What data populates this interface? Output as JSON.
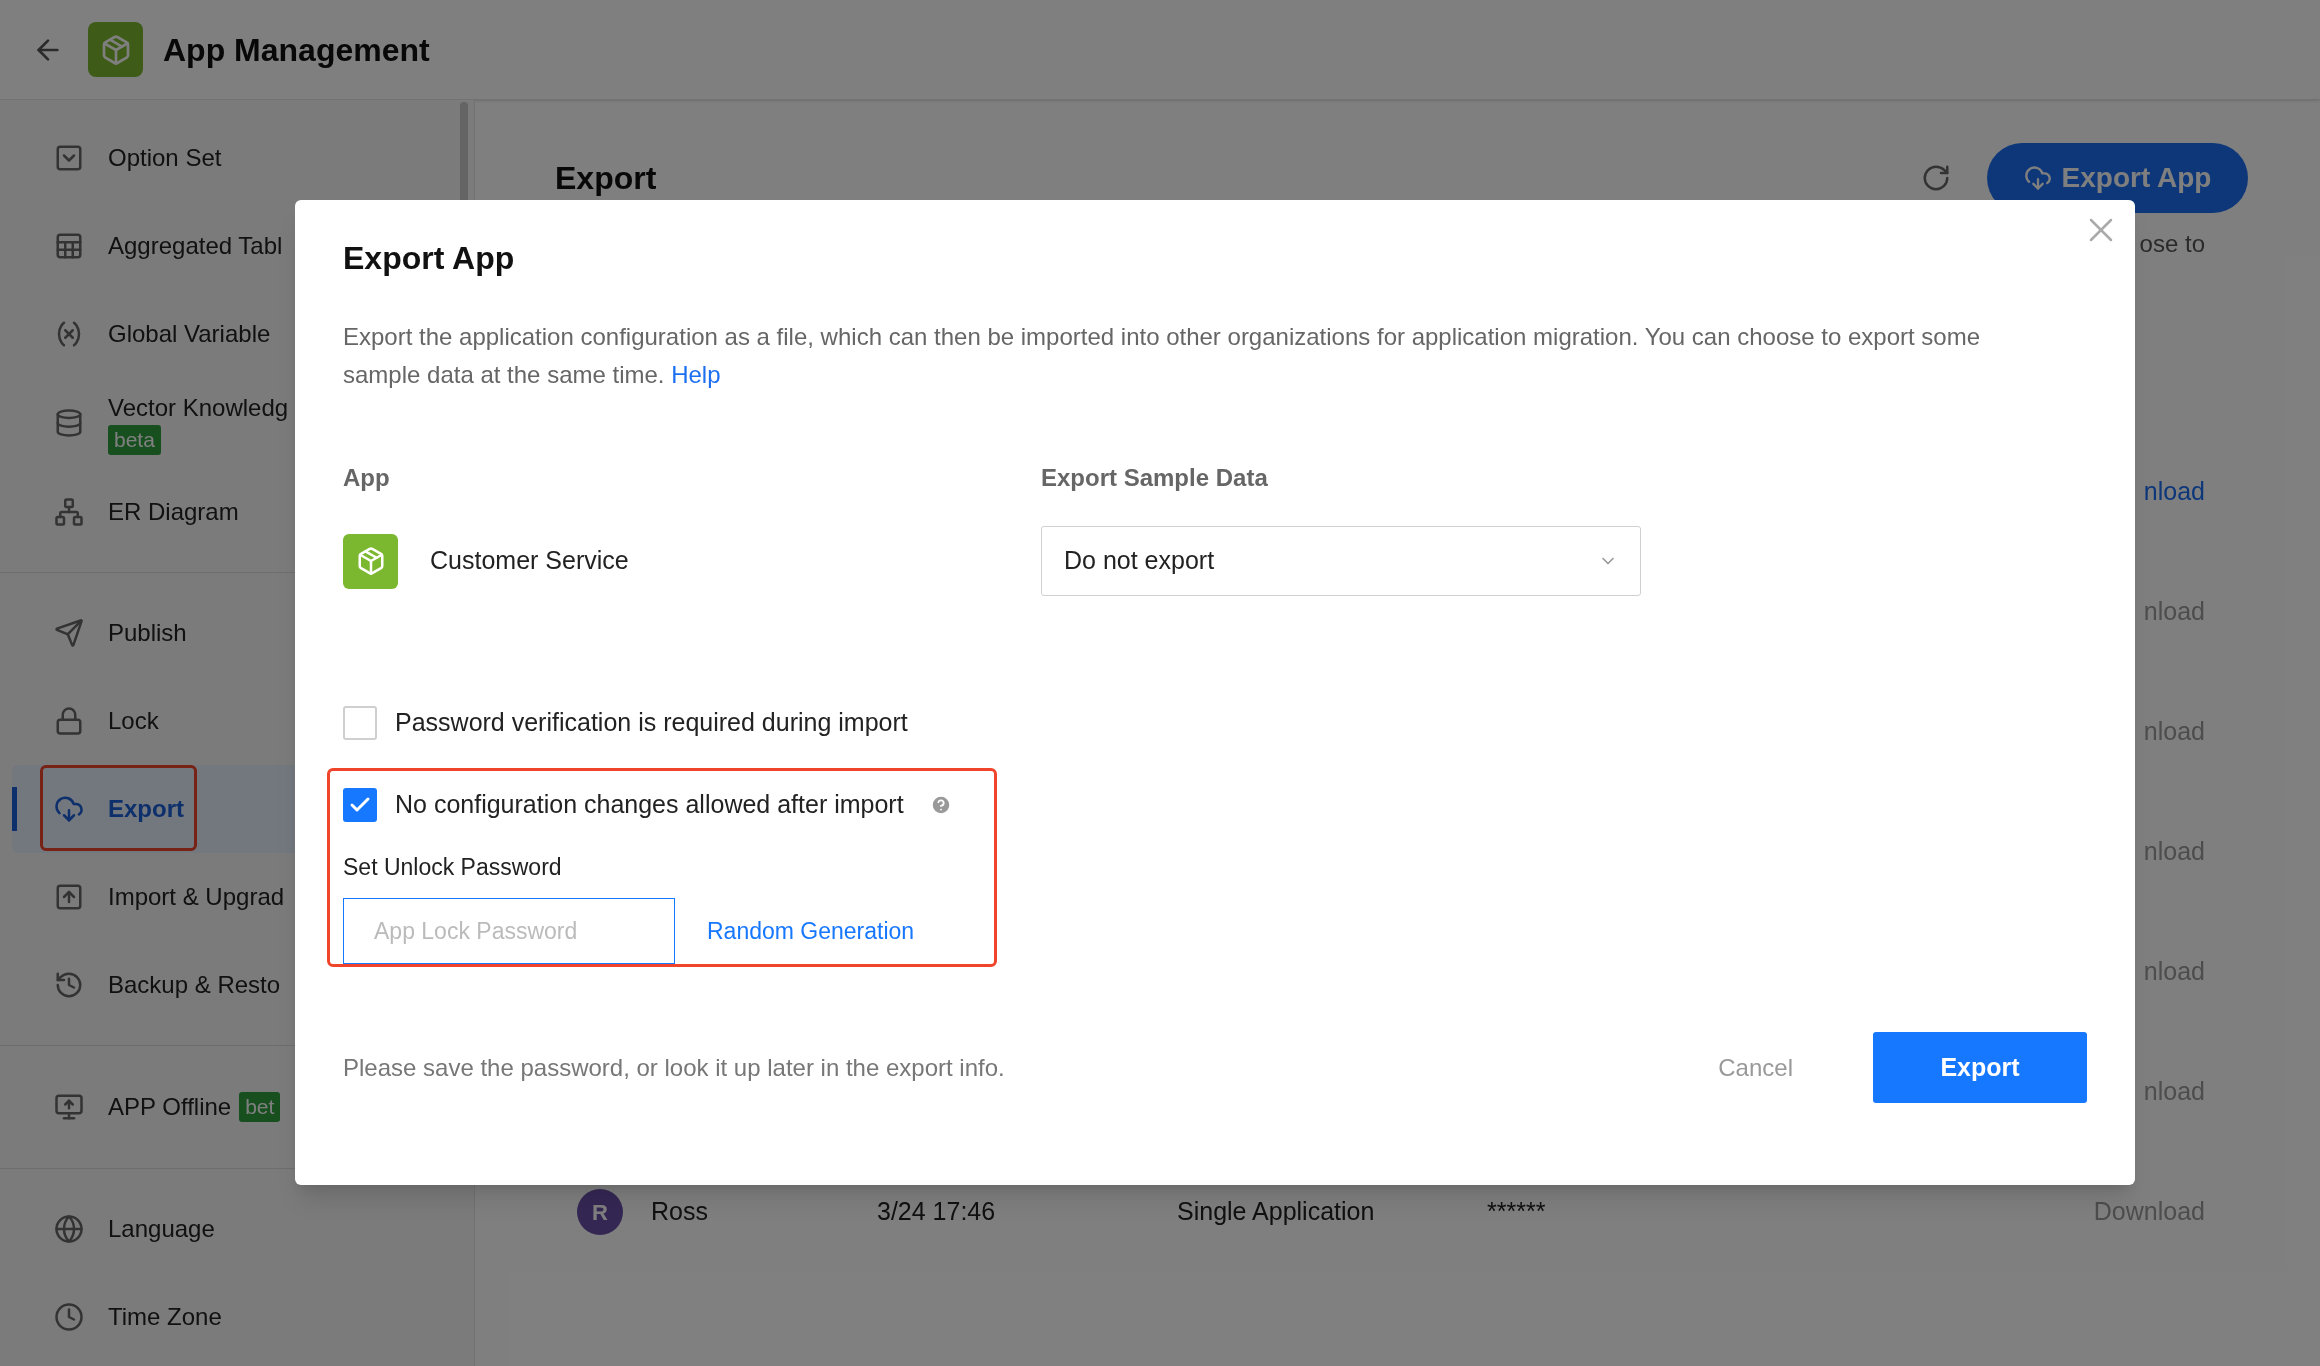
{
  "header": {
    "title": "App Management"
  },
  "sidebar": {
    "groups": [
      [
        {
          "label": "Option Set",
          "kind": "option",
          "selected": false,
          "highlighted": false
        },
        {
          "label": "Aggregated Tabl",
          "kind": "table",
          "selected": false,
          "highlighted": false
        },
        {
          "label": "Global Variable",
          "kind": "variable",
          "selected": false,
          "highlighted": false
        },
        {
          "label": "Vector Knowledg",
          "kind": "database",
          "badge": "beta",
          "selected": false,
          "highlighted": false
        },
        {
          "label": "ER Diagram",
          "kind": "diagram",
          "selected": false,
          "highlighted": false
        }
      ],
      [
        {
          "label": "Publish",
          "kind": "send",
          "selected": false,
          "highlighted": false
        },
        {
          "label": "Lock",
          "kind": "lock",
          "selected": false,
          "highlighted": false
        },
        {
          "label": "Export",
          "kind": "export",
          "selected": true,
          "highlighted": true
        },
        {
          "label": "Import & Upgrad",
          "kind": "import",
          "selected": false,
          "highlighted": false
        },
        {
          "label": "Backup & Resto",
          "kind": "backup",
          "selected": false,
          "highlighted": false
        }
      ],
      [
        {
          "label": "APP Offline",
          "kind": "offline",
          "badge": "bet",
          "selected": false,
          "highlighted": false
        }
      ],
      [
        {
          "label": "Language",
          "kind": "globe",
          "selected": false,
          "highlighted": false
        },
        {
          "label": "Time Zone",
          "kind": "clock",
          "selected": false,
          "highlighted": false
        }
      ]
    ]
  },
  "main": {
    "title": "Export",
    "export_button": "Export App",
    "note": "ose to",
    "rows": [
      {
        "action": "nload",
        "disabled": false
      },
      {
        "action": "nload",
        "disabled": true
      },
      {
        "action": "nload",
        "disabled": true
      },
      {
        "action": "nload",
        "disabled": true
      },
      {
        "action": "nload",
        "disabled": true
      },
      {
        "action": "nload",
        "disabled": true
      },
      {
        "avatar": "R",
        "name": "Ross",
        "time": "3/24 17:46",
        "type": "Single Application",
        "password": "******",
        "action": "Download",
        "disabled": true
      }
    ]
  },
  "dialog": {
    "title": "Export App",
    "description": "Export the application configuration as a file, which can then be imported into other organizations for application migration. You can choose to export some sample data at the same time.",
    "help_link": "Help",
    "app_label": "App",
    "app_name": "Customer Service",
    "sample_label": "Export Sample Data",
    "sample_value": "Do not export",
    "options": [
      {
        "label": "Password verification is required during import",
        "checked": false,
        "highlighted": false,
        "info": false
      },
      {
        "label": "No configuration changes allowed after import",
        "checked": true,
        "highlighted": true,
        "info": true,
        "unlock": {
          "label": "Set Unlock Password",
          "placeholder": "App Lock Password",
          "generate": "Random Generation"
        }
      }
    ],
    "footer_note": "Please save the password, or look it up later in the export info.",
    "cancel": "Cancel",
    "confirm": "Export"
  }
}
